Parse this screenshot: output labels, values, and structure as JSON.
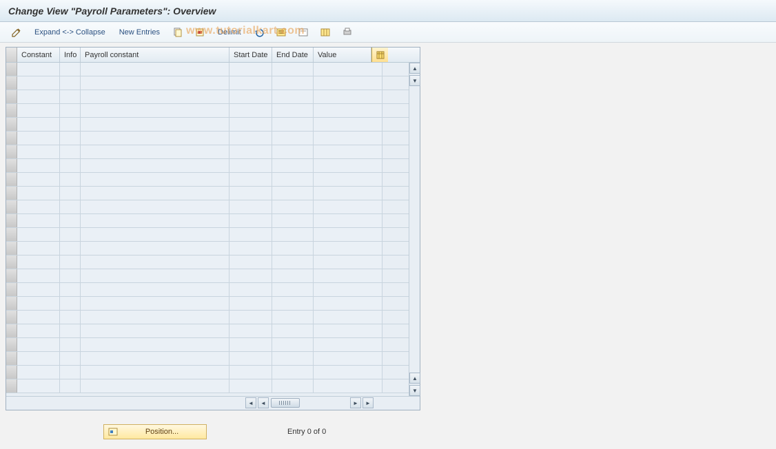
{
  "title": "Change View \"Payroll Parameters\": Overview",
  "toolbar": {
    "expand_collapse": "Expand <-> Collapse",
    "new_entries": "New Entries",
    "delimit": "Delimit"
  },
  "watermark": "www.tutorialkart.com",
  "table": {
    "columns": {
      "constant": "Constant",
      "info": "Info",
      "payroll_constant": "Payroll constant",
      "start_date": "Start Date",
      "end_date": "End Date",
      "value": "Value"
    },
    "rows": 24
  },
  "footer": {
    "position_label": "Position...",
    "entry_text": "Entry 0 of 0"
  }
}
